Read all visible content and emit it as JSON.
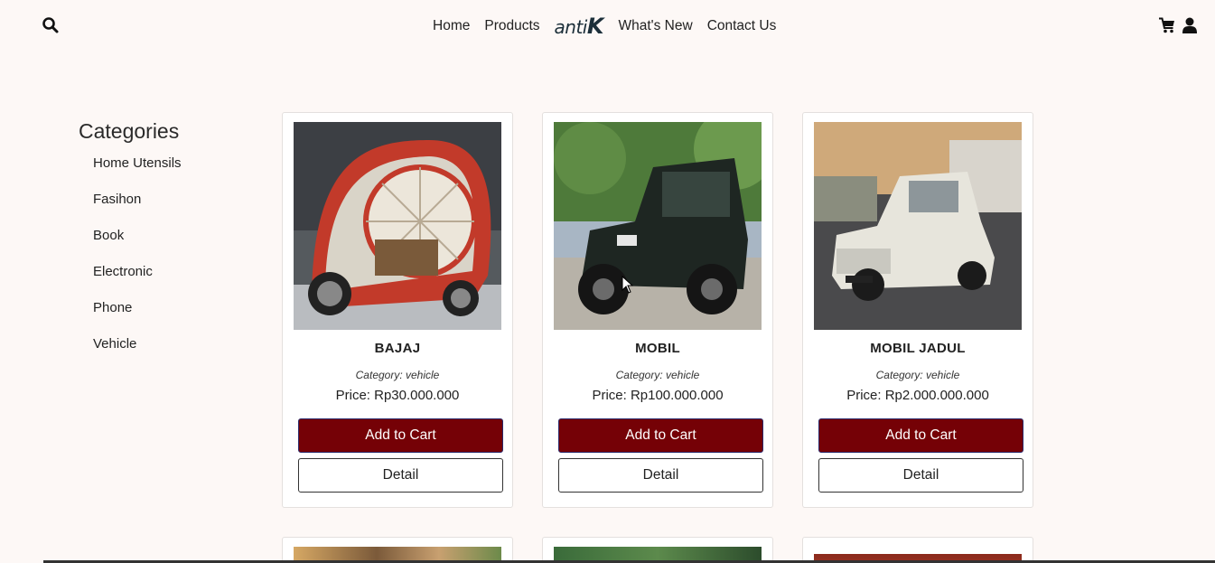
{
  "header": {
    "search_icon": "search-icon",
    "nav": {
      "home": "Home",
      "products": "Products",
      "logo_small": "anti",
      "logo_big": "K",
      "whats_new": "What's New",
      "contact": "Contact Us"
    },
    "cart_icon": "cart-icon",
    "user_icon": "user-icon"
  },
  "sidebar": {
    "title": "Categories",
    "items": [
      {
        "label": "Home Utensils"
      },
      {
        "label": "Fasihon"
      },
      {
        "label": "Book"
      },
      {
        "label": "Electronic"
      },
      {
        "label": "Phone"
      },
      {
        "label": "Vehicle"
      }
    ]
  },
  "products": [
    {
      "name": "BAJAJ",
      "category": "Category: vehicle",
      "price": "Price: Rp30.000.000",
      "add_label": "Add to Cart",
      "detail_label": "Detail"
    },
    {
      "name": "MOBIL",
      "category": "Category: vehicle",
      "price": "Price: Rp100.000.000",
      "add_label": "Add to Cart",
      "detail_label": "Detail"
    },
    {
      "name": "MOBIL JADUL",
      "category": "Category: vehicle",
      "price": "Price: Rp2.000.000.000",
      "add_label": "Add to Cart",
      "detail_label": "Detail"
    }
  ],
  "colors": {
    "background": "#fdf8f6",
    "add_to_cart": "#750106",
    "logo": "#1c2f3a"
  }
}
